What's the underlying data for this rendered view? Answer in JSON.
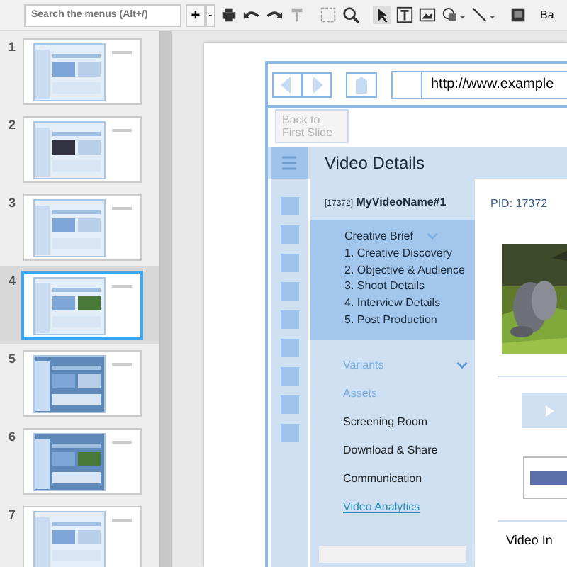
{
  "toolbar": {
    "search": {
      "placeholder": "Search the menus (Alt+/)"
    },
    "zoom_in": "+",
    "zoom_out": "-",
    "cut_label": "Ba"
  },
  "slides": [
    {
      "number": "1",
      "selected": false
    },
    {
      "number": "2",
      "selected": false
    },
    {
      "number": "3",
      "selected": false
    },
    {
      "number": "4",
      "selected": true
    },
    {
      "number": "5",
      "selected": false
    },
    {
      "number": "6",
      "selected": false
    },
    {
      "number": "7",
      "selected": false
    }
  ],
  "mockup": {
    "url": "http://www.example",
    "back_button": "Back to First Slide",
    "title": "Video Details",
    "video_id": "[17372]",
    "video_name": "MyVideoName#1",
    "brief": {
      "title": "Creative Brief",
      "steps": [
        "1. Creative Discovery",
        "2. Objective & Audience",
        "3. Shoot Details",
        "4. Interview Details",
        "5. Post Production"
      ]
    },
    "nav": [
      {
        "label": "Variants",
        "kind": "muted",
        "expandable": true
      },
      {
        "label": "Assets",
        "kind": "muted",
        "expandable": false
      },
      {
        "label": "Screening Room",
        "kind": "plain",
        "expandable": false
      },
      {
        "label": "Download & Share",
        "kind": "plain",
        "expandable": false
      },
      {
        "label": "Communication",
        "kind": "plain",
        "expandable": false
      },
      {
        "label": "Video Analytics",
        "kind": "link",
        "expandable": false
      }
    ],
    "pid": "PID: 17372",
    "section_label": "Video In"
  }
}
